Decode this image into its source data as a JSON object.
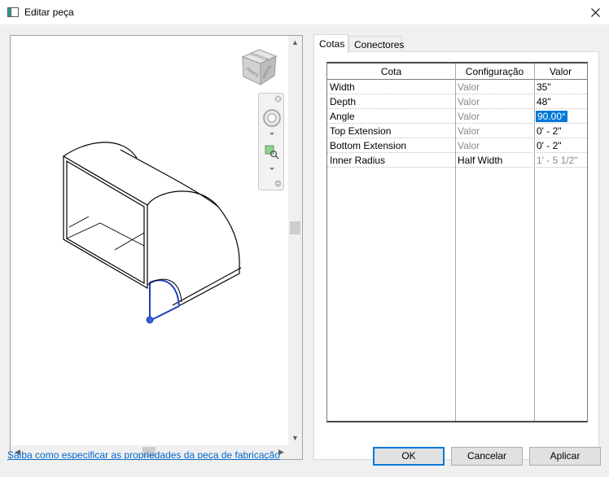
{
  "window": {
    "title": "Editar peça"
  },
  "tabs": [
    {
      "label": "Cotas"
    },
    {
      "label": "Conectores"
    }
  ],
  "viewcube": {
    "face_top": "SUPERIOR",
    "face_front": "FRENTE",
    "face_right": "DIREITA"
  },
  "grid": {
    "headers": [
      "Cota",
      "Configuração",
      "Valor"
    ],
    "rows": [
      {
        "name": "Width",
        "config": "Valor",
        "value": "35\""
      },
      {
        "name": "Depth",
        "config": "Valor",
        "value": "48\""
      },
      {
        "name": "Angle",
        "config": "Valor",
        "value": "90.00°"
      },
      {
        "name": "Top Extension",
        "config": "Valor",
        "value": "0' - 2\""
      },
      {
        "name": "Bottom Extension",
        "config": "Valor",
        "value": "0' - 2\""
      },
      {
        "name": "Inner Radius",
        "config": "Half Width",
        "value": "1' - 5 1/2\""
      }
    ]
  },
  "footer": {
    "help_link": "Saiba como especificar as propriedades da peça de fabricação",
    "ok": "OK",
    "cancel": "Cancelar",
    "apply": "Aplicar"
  },
  "colors": {
    "accent": "#0078d7",
    "link": "#0066cc",
    "model_highlight": "#1f3fbf"
  }
}
